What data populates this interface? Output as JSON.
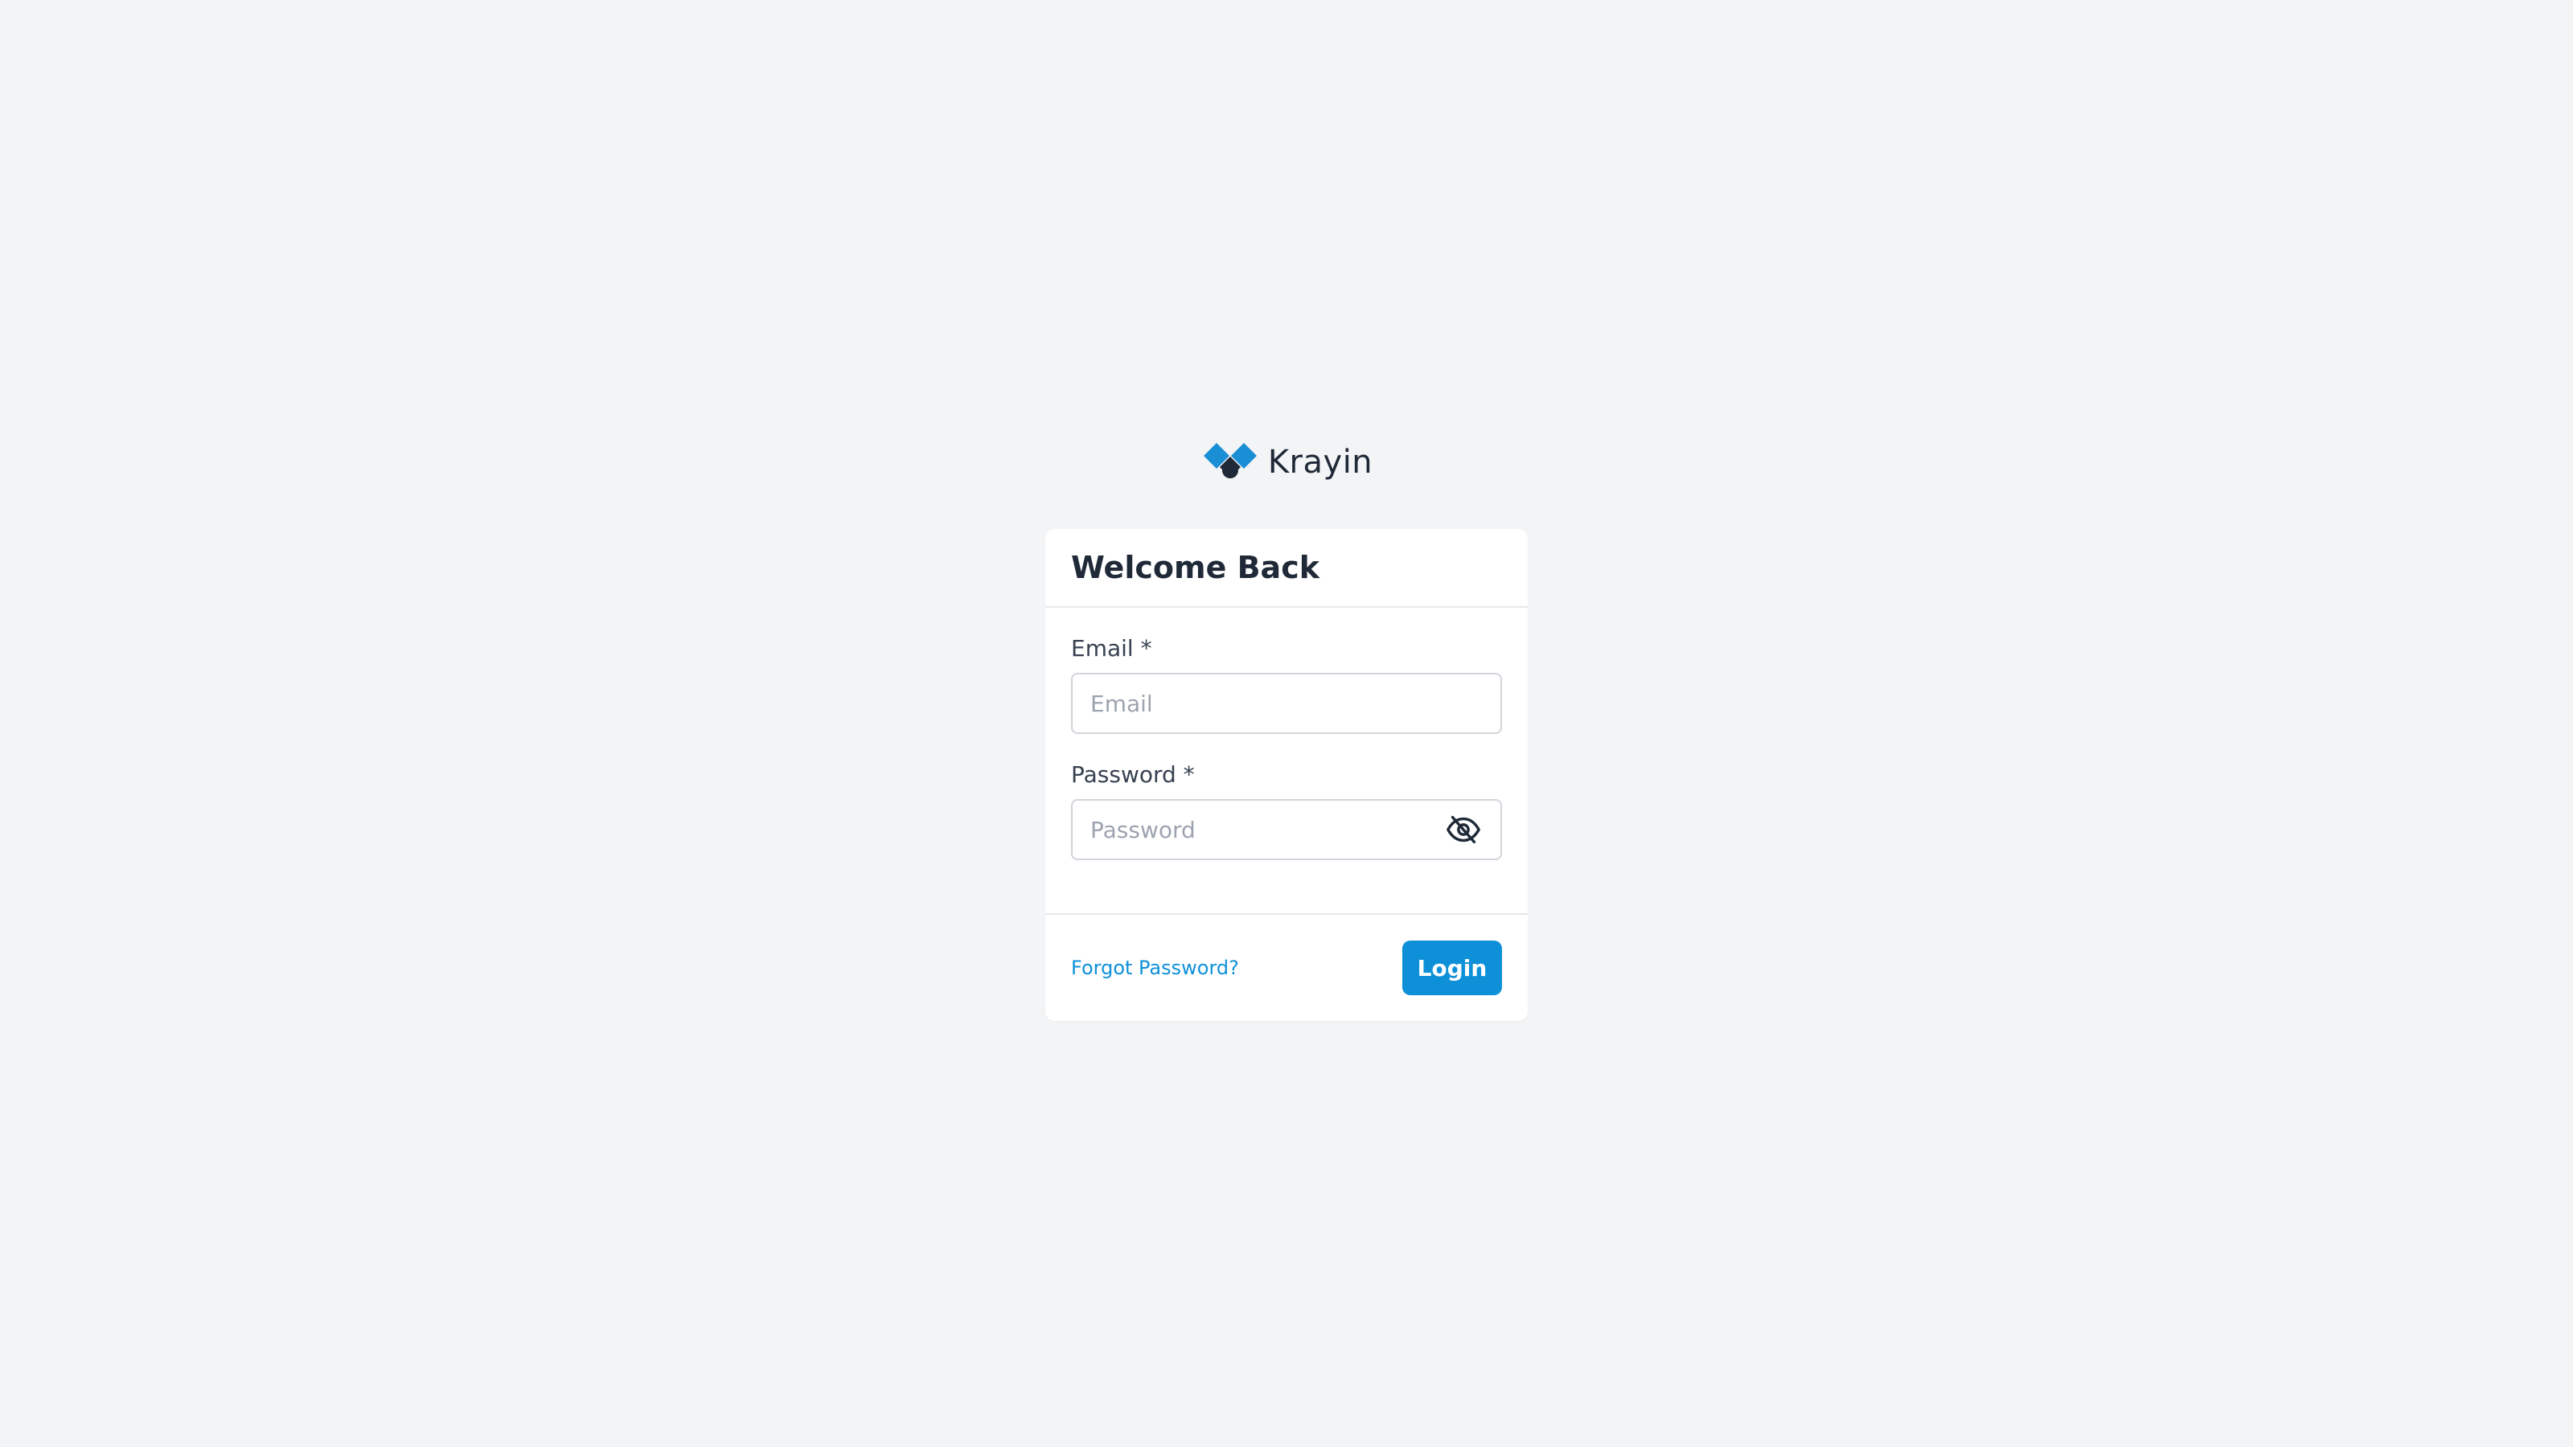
{
  "brand": {
    "name": "Krayin",
    "logo_icon": "krayin-logo-icon",
    "colors": {
      "accent": "#0e90d9",
      "dark": "#1f2937"
    }
  },
  "login_form": {
    "title": "Welcome Back",
    "email": {
      "label": "Email *",
      "placeholder": "Email",
      "value": ""
    },
    "password": {
      "label": "Password *",
      "placeholder": "Password",
      "value": "",
      "toggle_icon": "eye-slash-icon"
    },
    "forgot_password_label": "Forgot Password?",
    "login_label": "Login"
  }
}
